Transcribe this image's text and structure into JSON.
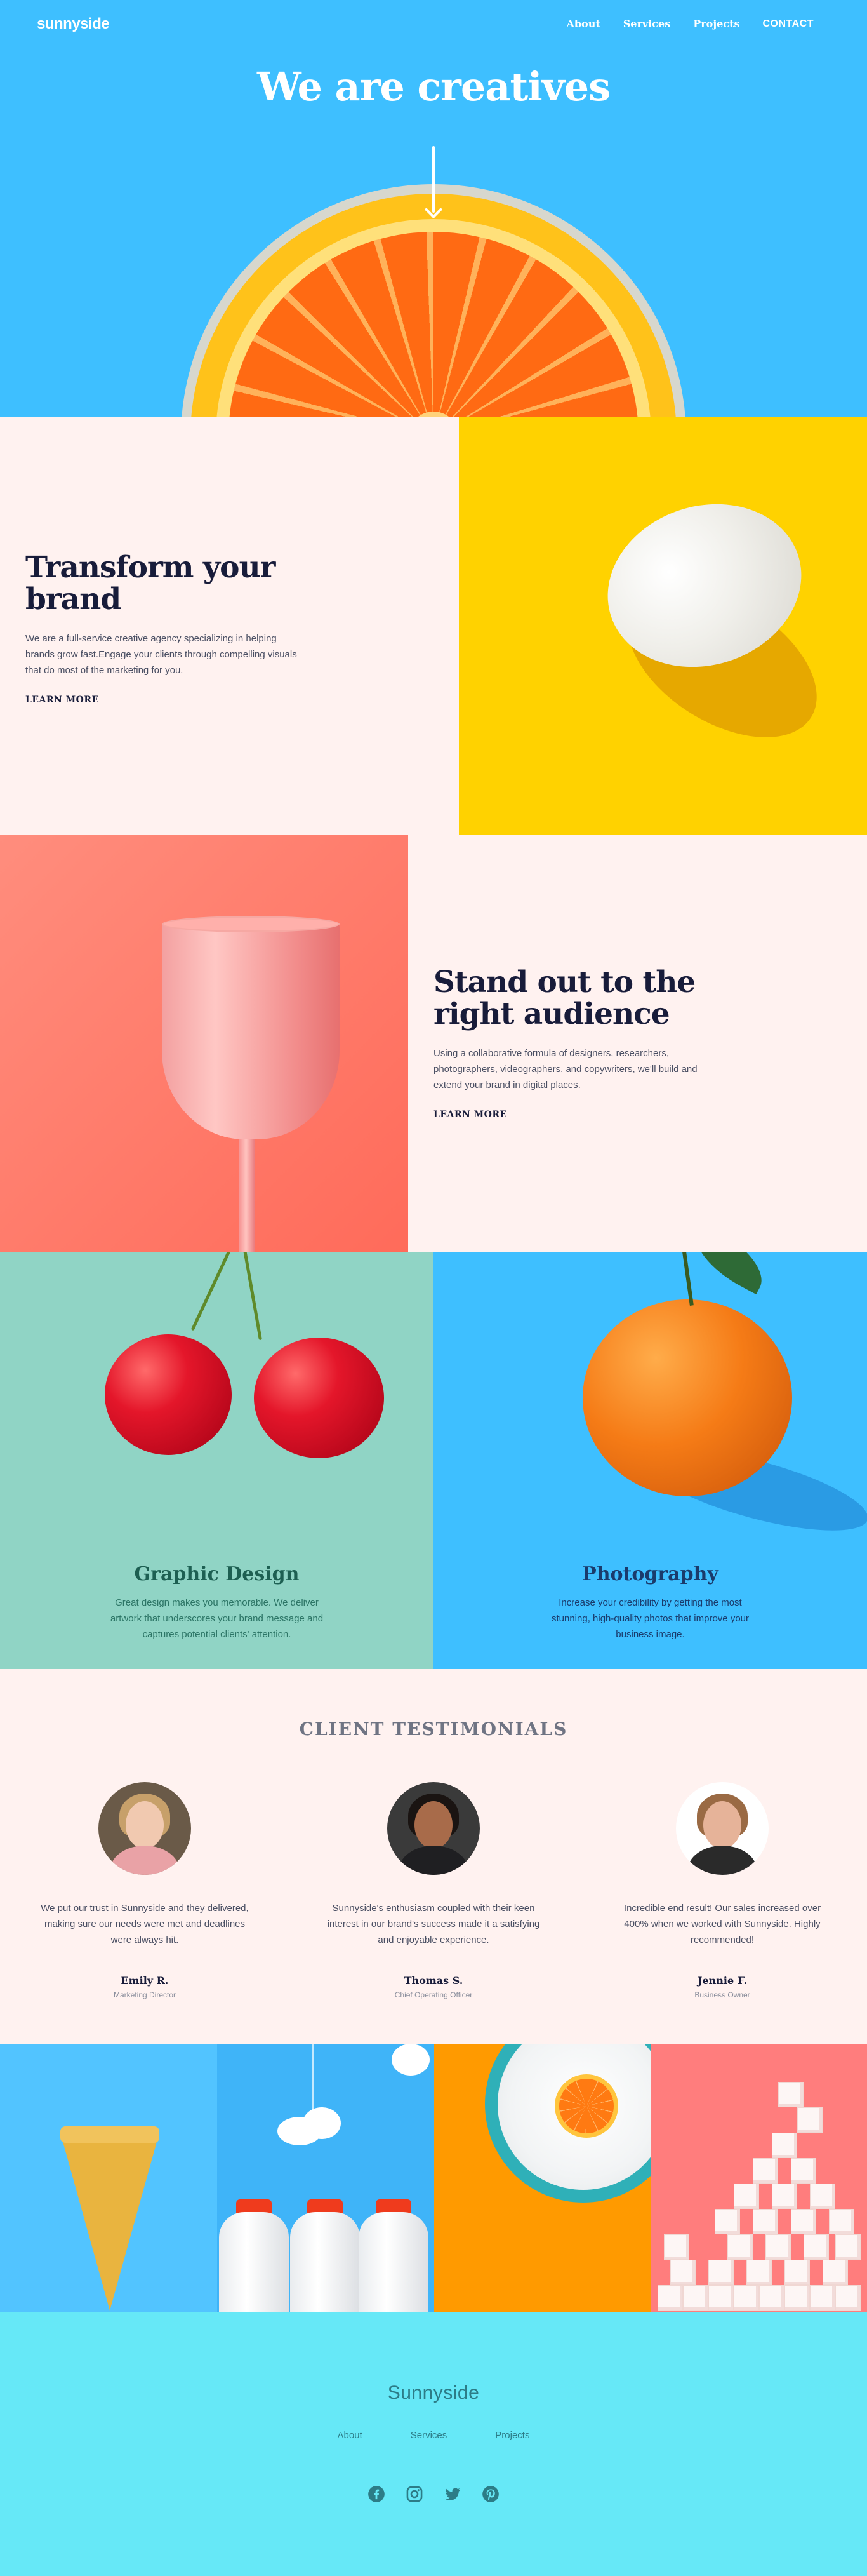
{
  "header": {
    "logo": "sunnyside",
    "nav": [
      {
        "label": "About"
      },
      {
        "label": "Services"
      },
      {
        "label": "Projects"
      },
      {
        "label": "CONTACT"
      }
    ]
  },
  "hero": {
    "title": "We are creatives",
    "arrow_icon": "arrow-down-icon"
  },
  "transform": {
    "title": "Transform your brand",
    "body": "We are a full-service creative agency specializing in helping brands grow fast.Engage your clients through compelling visuals that do most of the marketing for you.",
    "link": "LEARN MORE"
  },
  "standout": {
    "title": "Stand out to the right audience",
    "body": "Using a collaborative formula of designers, researchers, photographers, videographers, and copywriters, we'll build and extend your brand in digital places.",
    "link": "LEARN MORE"
  },
  "services": [
    {
      "title": "Graphic Design",
      "desc": "Great design makes you memorable. We deliver artwork that underscores your brand message and captures potential clients' attention."
    },
    {
      "title": "Photography",
      "desc": "Increase your credibility by getting the most stunning, high-quality photos that improve your business image."
    }
  ],
  "testimonials": {
    "heading": "CLIENT TESTIMONIALS",
    "items": [
      {
        "quote": "We put our trust in Sunnyside and they delivered, making sure our needs were met and deadlines were always hit.",
        "name": "Emily R.",
        "role": "Marketing Director"
      },
      {
        "quote": "Sunnyside's enthusiasm coupled with their keen interest in our brand's success made it a satisfying and enjoyable experience.",
        "name": "Thomas S.",
        "role": "Chief Operating Officer"
      },
      {
        "quote": "Incredible end result! Our sales increased over 400% when we worked with Sunnyside. Highly recommended!",
        "name": "Jennie F.",
        "role": "Business Owner"
      }
    ]
  },
  "footer": {
    "logo": "Sunnyside",
    "nav": [
      {
        "label": "About"
      },
      {
        "label": "Services"
      },
      {
        "label": "Projects"
      }
    ],
    "social_icons": [
      "facebook-icon",
      "instagram-icon",
      "twitter-icon",
      "pinterest-icon"
    ]
  },
  "colors": {
    "hero_bg": "#3ebfff",
    "yellow": "#ffd200",
    "salmon": "#ff7d6b",
    "teal": "#90d4c5",
    "footer_bg": "#66e8f7",
    "dark_text": "#181c3a"
  }
}
